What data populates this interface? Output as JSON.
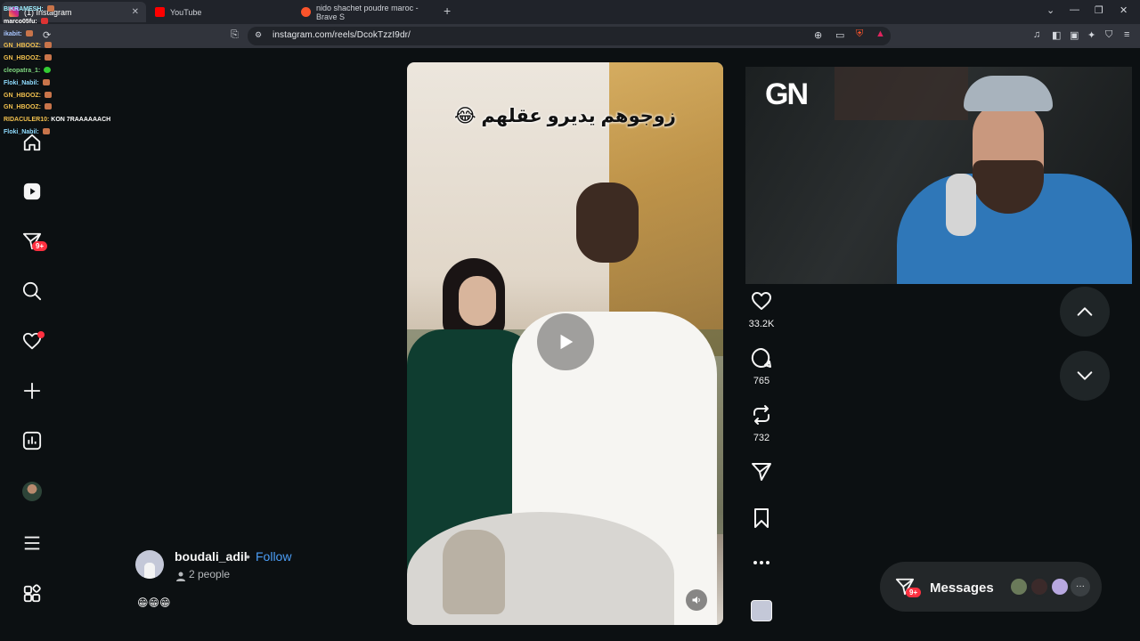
{
  "browser": {
    "tabs": [
      {
        "label": "(1) Instagram",
        "active": true
      },
      {
        "label": "YouTube",
        "active": false
      },
      {
        "label": "nido shachet poudre maroc - Brave S",
        "active": false
      }
    ],
    "new_tab": "+",
    "url": "instagram.com/reels/DcokTzzI9dr/"
  },
  "chat": [
    {
      "user": "BIKRAMESH:",
      "msg": ""
    },
    {
      "user": "marco05fu:",
      "msg": ""
    },
    {
      "user": "ikabit:",
      "msg": ""
    },
    {
      "user": "GN_HBOOZ:",
      "msg": ""
    },
    {
      "user": "GN_HBOOZ:",
      "msg": ""
    },
    {
      "user": "cleopatra_1:",
      "msg": ""
    },
    {
      "user": "Floki_Nabil:",
      "msg": ""
    },
    {
      "user": "GN_HBOOZ:",
      "msg": ""
    },
    {
      "user": "GN_HBOOZ:",
      "msg": ""
    },
    {
      "user": "RIDACULER10:",
      "msg": "KON 7RAAAAAACH"
    },
    {
      "user": "Floki_Nabil:",
      "msg": ""
    }
  ],
  "sidebar": {
    "messages_badge": "9+"
  },
  "reel": {
    "caption": "زوجوهم يديرو عقلهم 😂"
  },
  "actions": {
    "likes": "33.2K",
    "comments": "765",
    "reposts": "732"
  },
  "stream": {
    "logo": "GN"
  },
  "profile": {
    "username": "boudali_adil",
    "separator": "•",
    "follow": "Follow",
    "people": "2 people",
    "emojis": "😁😁😁"
  },
  "messages": {
    "label": "Messages",
    "badge": "9+",
    "more": "···"
  },
  "colors": {
    "background": "#0c1012",
    "accent_link": "#4c9ef7",
    "badge_red": "#ff3040"
  }
}
